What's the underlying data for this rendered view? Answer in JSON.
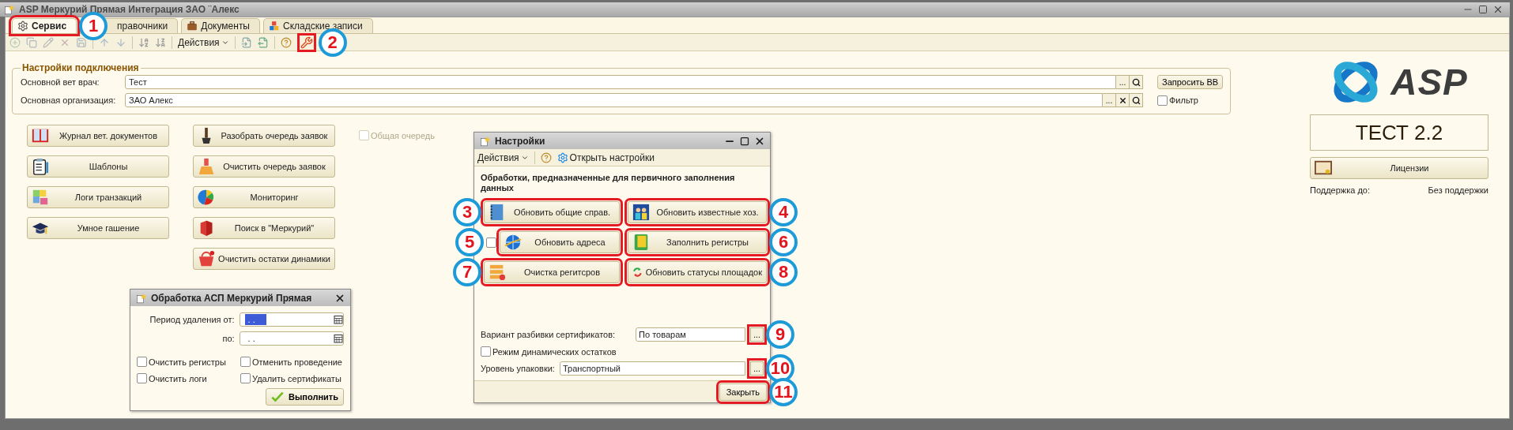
{
  "window": {
    "title": "ASP Меркурий Прямая Интеграция ЗАО ¨Алекс"
  },
  "tabs": [
    {
      "label": "Сервис",
      "selected": true,
      "callout": "1"
    },
    {
      "label": "правочники",
      "selected": false
    },
    {
      "label": "Документы",
      "selected": false
    },
    {
      "label": "Складские записи",
      "selected": false
    }
  ],
  "toolbar": {
    "actions": "Действия",
    "tools_callout": "2"
  },
  "connection": {
    "title": "Настройки подключения",
    "choose_label": "...",
    "request_button": "Запросить ВВ",
    "filter": {
      "label": "Фильтр",
      "checked": false
    },
    "fields": [
      {
        "label": "Основной вет врач:",
        "value": "Тест"
      },
      {
        "label": "Основная организация:",
        "value": "ЗАО  Алекс"
      }
    ]
  },
  "actions_left": [
    "Журнал вет. документов",
    "Шаблоны",
    "Логи транзакций",
    "Умное гашение"
  ],
  "actions_right": [
    "Разобрать очередь заявок",
    "Очистить очередь заявок",
    "Мониторинг",
    "Поиск в \"Меркурий\"",
    "Очистить остатки динамики"
  ],
  "shared_queue": {
    "label": "Общая очередь",
    "checked": false,
    "disabled": true
  },
  "brand": {
    "logo_text": "ASP",
    "version": "ТЕСТ 2.2",
    "licenses_button": "Лицензии",
    "support_label": "Поддержка до:",
    "support_value": "Без поддержки"
  },
  "cleanup_dialog": {
    "title": "Обработка  АСП Меркурий Прямая",
    "run_button": "Выполнить",
    "dates": [
      {
        "label": "Период удаления от:",
        "value": ". .",
        "selected": true
      },
      {
        "label": "по:",
        "value": ". .",
        "selected": false
      }
    ],
    "options": [
      {
        "label": "Очистить регистры",
        "checked": false
      },
      {
        "label": "Отменить проведение",
        "checked": false
      },
      {
        "label": "Очистить логи",
        "checked": false
      },
      {
        "label": "Удалить сертификаты",
        "checked": false
      }
    ]
  },
  "settings_dialog": {
    "title": "Настройки",
    "actions": "Действия",
    "open_settings": "Открыть настройки",
    "heading": "Обработки, предназначенные для первичного заполнения данных",
    "buttons": [
      {
        "label": "Обновить общие справ.",
        "callout": "3"
      },
      {
        "label": "Обновить известные хоз.",
        "callout": "4"
      },
      {
        "label": "Обновить адреса",
        "callout": "5",
        "checked": false
      },
      {
        "label": "Заполнить регистры",
        "callout": "6"
      },
      {
        "label": "Очистка регитсров",
        "callout": "7"
      },
      {
        "label": "Обновить статусы площадок",
        "callout": "8"
      }
    ],
    "split": {
      "label": "Вариант разбивки сертификатов:",
      "value": "По товарам",
      "choose_label": "...",
      "callout": "9"
    },
    "dynamic_mode": {
      "label": "Режим динамических остатков",
      "checked": false
    },
    "packaging": {
      "label": "Уровень упаковки:",
      "value": "Транспортный",
      "choose_label": "...",
      "callout": "10"
    },
    "close_button": {
      "label": "Закрыть",
      "callout": "11"
    }
  }
}
